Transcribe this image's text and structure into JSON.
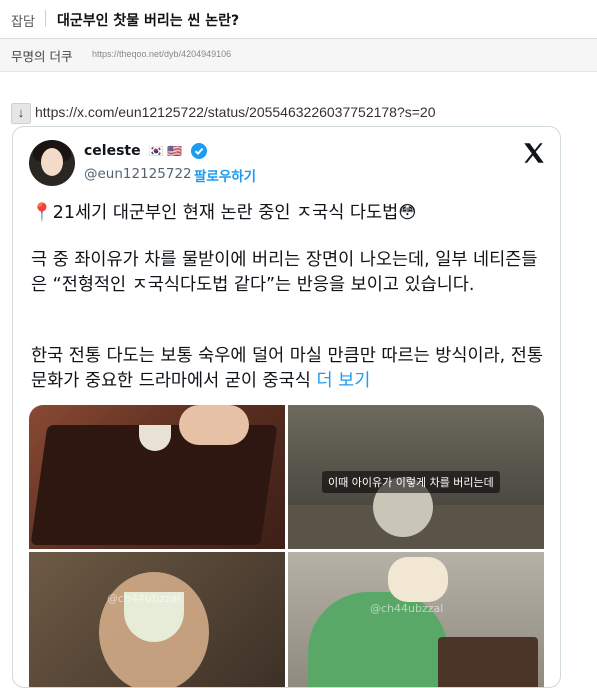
{
  "post": {
    "category": "잡담",
    "title": "대군부인 찻물 버리는 씬 논란?",
    "author": "무명의 더쿠",
    "source_url": "https://theqoo.net/dyb/4204949106",
    "link_arrow": "↓",
    "link": "https://x.com/eun12125722/status/2055463226037752178?s=20"
  },
  "tweet": {
    "name": "celeste",
    "flags": "🇰🇷 🇺🇸",
    "handle": "@eun12125722",
    "follow_label": "팔로우하기",
    "line1": "📍21세기 대군부인 현재 논란 중인 ㅈ국식 다도법😳",
    "line2": "극 중 좌이유가 차를 물받이에 버리는 장면이 나오는데, 일부 네티즌들은 “전형적인 ㅈ국식다도법 같다”는 반응을 보이고 있습니다.",
    "line3": "한국 전통 다도는 보통 숙우에 덜어 마실 만큼만 따르는 방식이라, 전통문화가 중요한 드라마에서 굳이 중국식",
    "more_label": "더 보기",
    "media": {
      "caption": "이때 아이유가 이렇게 차를 버리는데",
      "watermark": "@ch44ubzzal"
    }
  }
}
